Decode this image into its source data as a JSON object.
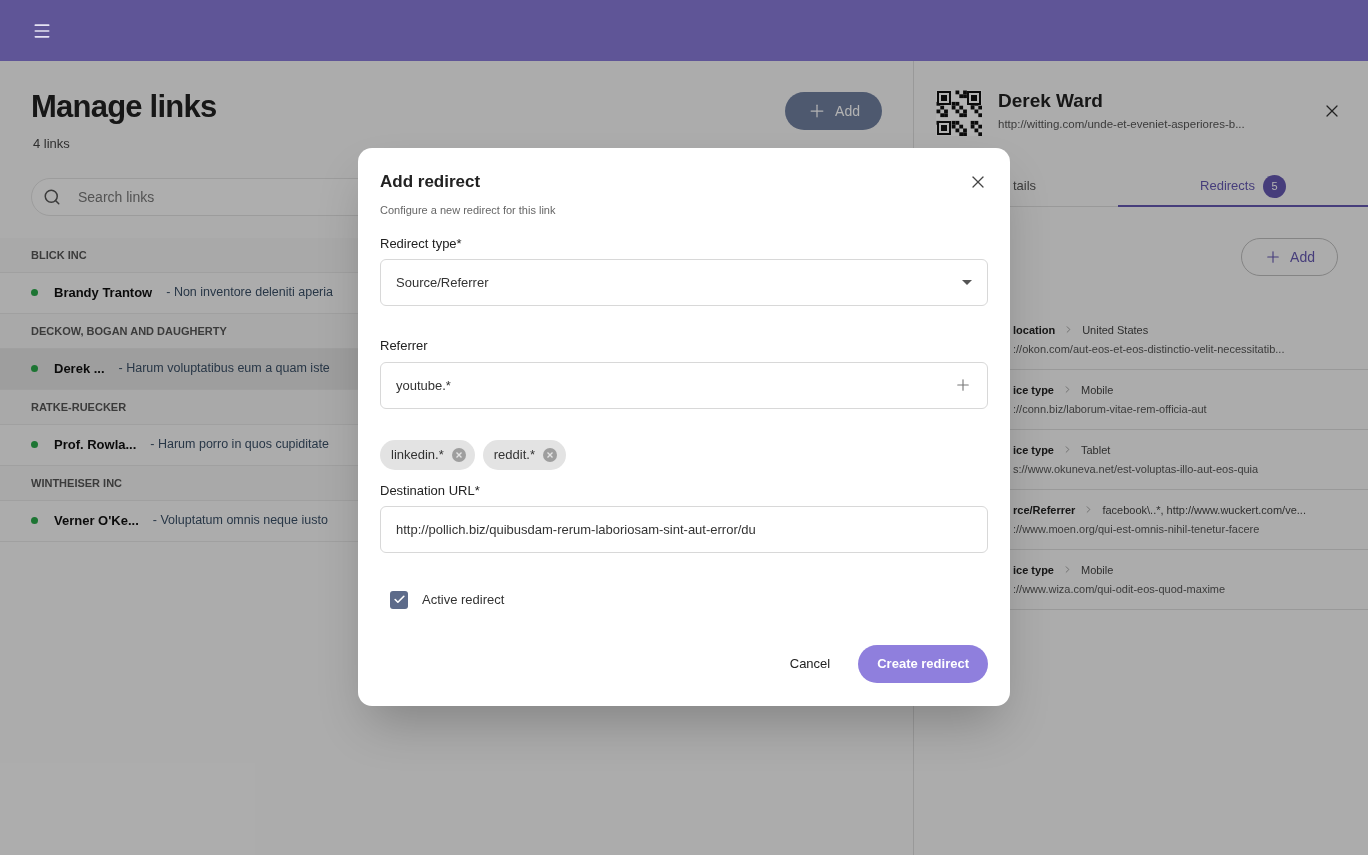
{
  "main": {
    "title": "Manage links",
    "count": "4 links",
    "search": {
      "placeholder": "Search links"
    },
    "add_button": "Add",
    "groups": [
      {
        "name": "BLICK INC",
        "links": [
          {
            "name": "Brandy Trantow",
            "description": "- Non inventore deleniti aperia",
            "active": true,
            "selected": false
          }
        ]
      },
      {
        "name": "DECKOW, BOGAN AND DAUGHERTY",
        "links": [
          {
            "name": "Derek ...",
            "description": "- Harum voluptatibus eum a quam iste",
            "active": true,
            "selected": true
          }
        ]
      },
      {
        "name": "RATKE-RUECKER",
        "links": [
          {
            "name": "Prof. Rowla...",
            "description": "- Harum porro in quos cupiditate",
            "active": true,
            "selected": false
          }
        ]
      },
      {
        "name": "WINTHEISER INC",
        "links": [
          {
            "name": "Verner O'Ke...",
            "description": "- Voluptatum omnis neque iusto",
            "active": true,
            "selected": false
          }
        ]
      }
    ]
  },
  "detail": {
    "name": "Derek Ward",
    "url": "http://witting.com/unde-et-eveniet-asperiores-b...",
    "tabs": [
      {
        "label": "tails",
        "selected": false
      },
      {
        "label": "Redirects",
        "selected": true,
        "badge": "5"
      }
    ],
    "add_button": "Add",
    "redirects": [
      {
        "type": "location",
        "value": "United States",
        "url": "://okon.com/aut-eos-et-eos-distinctio-velit-necessitatib..."
      },
      {
        "type": "ice type",
        "value": "Mobile",
        "url": "://conn.biz/laborum-vitae-rem-officia-aut"
      },
      {
        "type": "ice type",
        "value": "Tablet",
        "url": "s://www.okuneva.net/est-voluptas-illo-aut-eos-quia"
      },
      {
        "type": "rce/Referrer",
        "value": "facebook\\..*, http://www.wuckert.com/ve...",
        "url": "://www.moen.org/qui-est-omnis-nihil-tenetur-facere"
      },
      {
        "type": "ice type",
        "value": "Mobile",
        "url": "://www.wiza.com/qui-odit-eos-quod-maxime"
      }
    ]
  },
  "dialog": {
    "title": "Add redirect",
    "subtitle": "Configure a new redirect for this link",
    "redirect_type": {
      "label": "Redirect type*",
      "value": "Source/Referrer"
    },
    "referrer": {
      "label": "Referrer",
      "value": "youtube.*"
    },
    "chips": [
      "linkedin.*",
      "reddit.*"
    ],
    "destination": {
      "label": "Destination URL*",
      "value": "http://pollich.biz/quibusdam-rerum-laboriosam-sint-aut-error/du"
    },
    "active": {
      "label": "Active redirect",
      "checked": true
    },
    "cancel": "Cancel",
    "submit": "Create redirect"
  }
}
